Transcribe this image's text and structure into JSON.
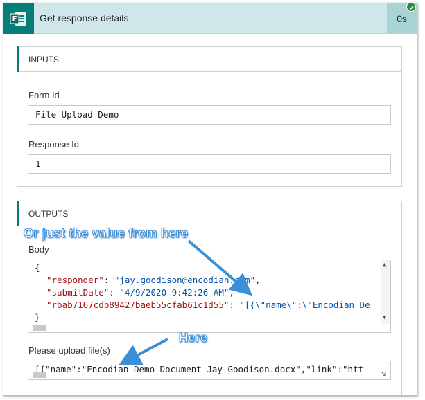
{
  "action": {
    "title": "Get response details",
    "duration": "0s",
    "status": "success",
    "icon": "forms-icon",
    "accent_color": "#077d79"
  },
  "inputs": {
    "header": "INPUTS",
    "form_id_label": "Form Id",
    "form_id_value": "File Upload Demo",
    "response_id_label": "Response Id",
    "response_id_value": "1"
  },
  "outputs": {
    "header": "OUTPUTS",
    "body_label": "Body",
    "body_lines": {
      "open": "{",
      "line1_key": "\"responder\"",
      "line1_sep": ": ",
      "line1_value": "\"jay.goodison@encodian.com\"",
      "line1_end": ",",
      "line2_key": "\"submitDate\"",
      "line2_sep": ": ",
      "line2_value": "\"4/9/2020 9:42:26 AM\"",
      "line2_end": ",",
      "line3_key": "\"rbab7167cdb89427baeb55cfab61c1d55\"",
      "line3_sep": ": ",
      "line3_value": "\"[{\\\"name\\\":\\\"Encodian De",
      "close": "}"
    },
    "upload_label": "Please upload file(s)",
    "upload_value": "[{\"name\":\"Encodian Demo Document_Jay Goodison.docx\",\"link\":\"htt"
  },
  "annotations": {
    "top": "Or just the value from here",
    "bottom": "Here",
    "color": "#3a8fd6"
  }
}
